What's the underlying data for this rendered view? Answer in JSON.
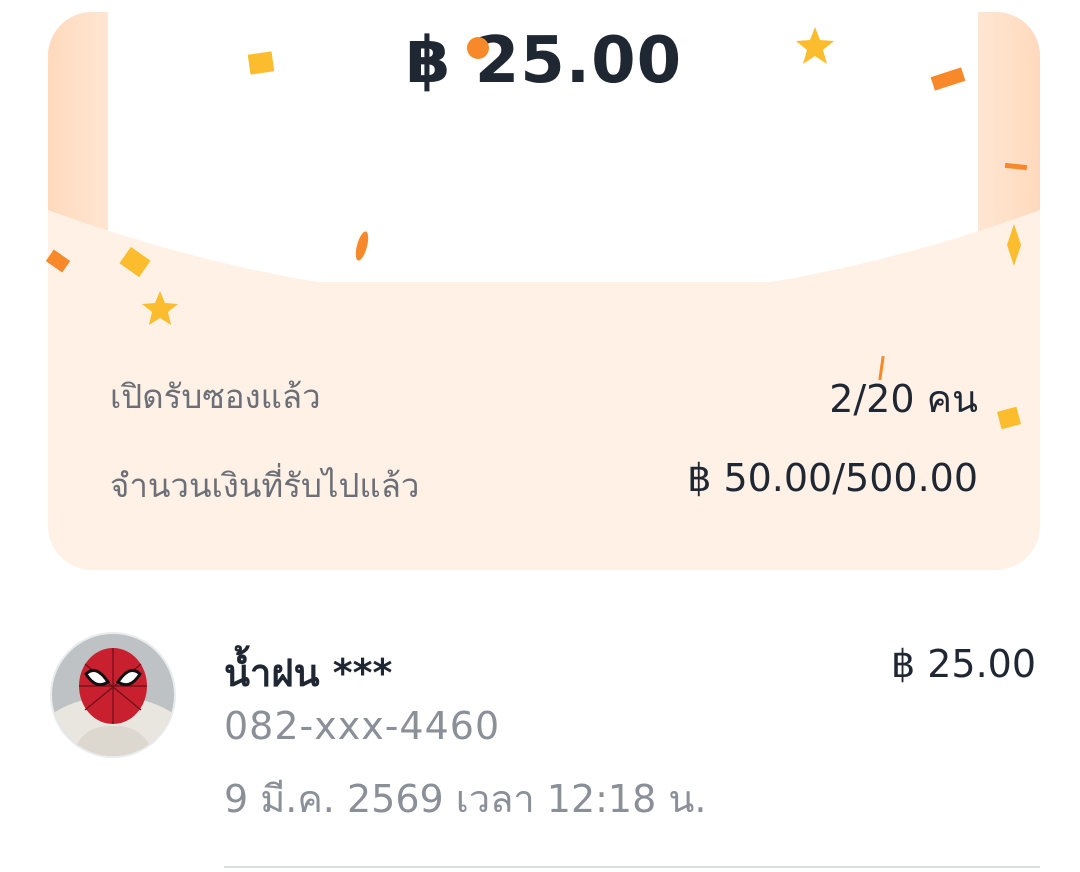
{
  "envelope": {
    "amount_received": "฿ 25.00"
  },
  "stats": {
    "opened_label": "เปิดรับซองแล้ว",
    "opened_value": "2/20 คน",
    "amount_label": "จำนวนเงินที่รับไปแล้ว",
    "amount_value": "฿ 50.00/500.00"
  },
  "recipients": [
    {
      "name": "น้ำฝน ***",
      "phone": "082-xxx-4460",
      "datetime": "9 มี.ค. 2569 เวลา 12:18 น.",
      "amount": "฿ 25.00",
      "avatar_icon": "spiderman-avatar"
    }
  ],
  "colors": {
    "card_bg": "#fff1e6",
    "confetti_yellow": "#fbbd2e",
    "confetti_orange": "#f7892a",
    "text_dark": "#1f2733",
    "text_muted": "#8a8f98"
  }
}
